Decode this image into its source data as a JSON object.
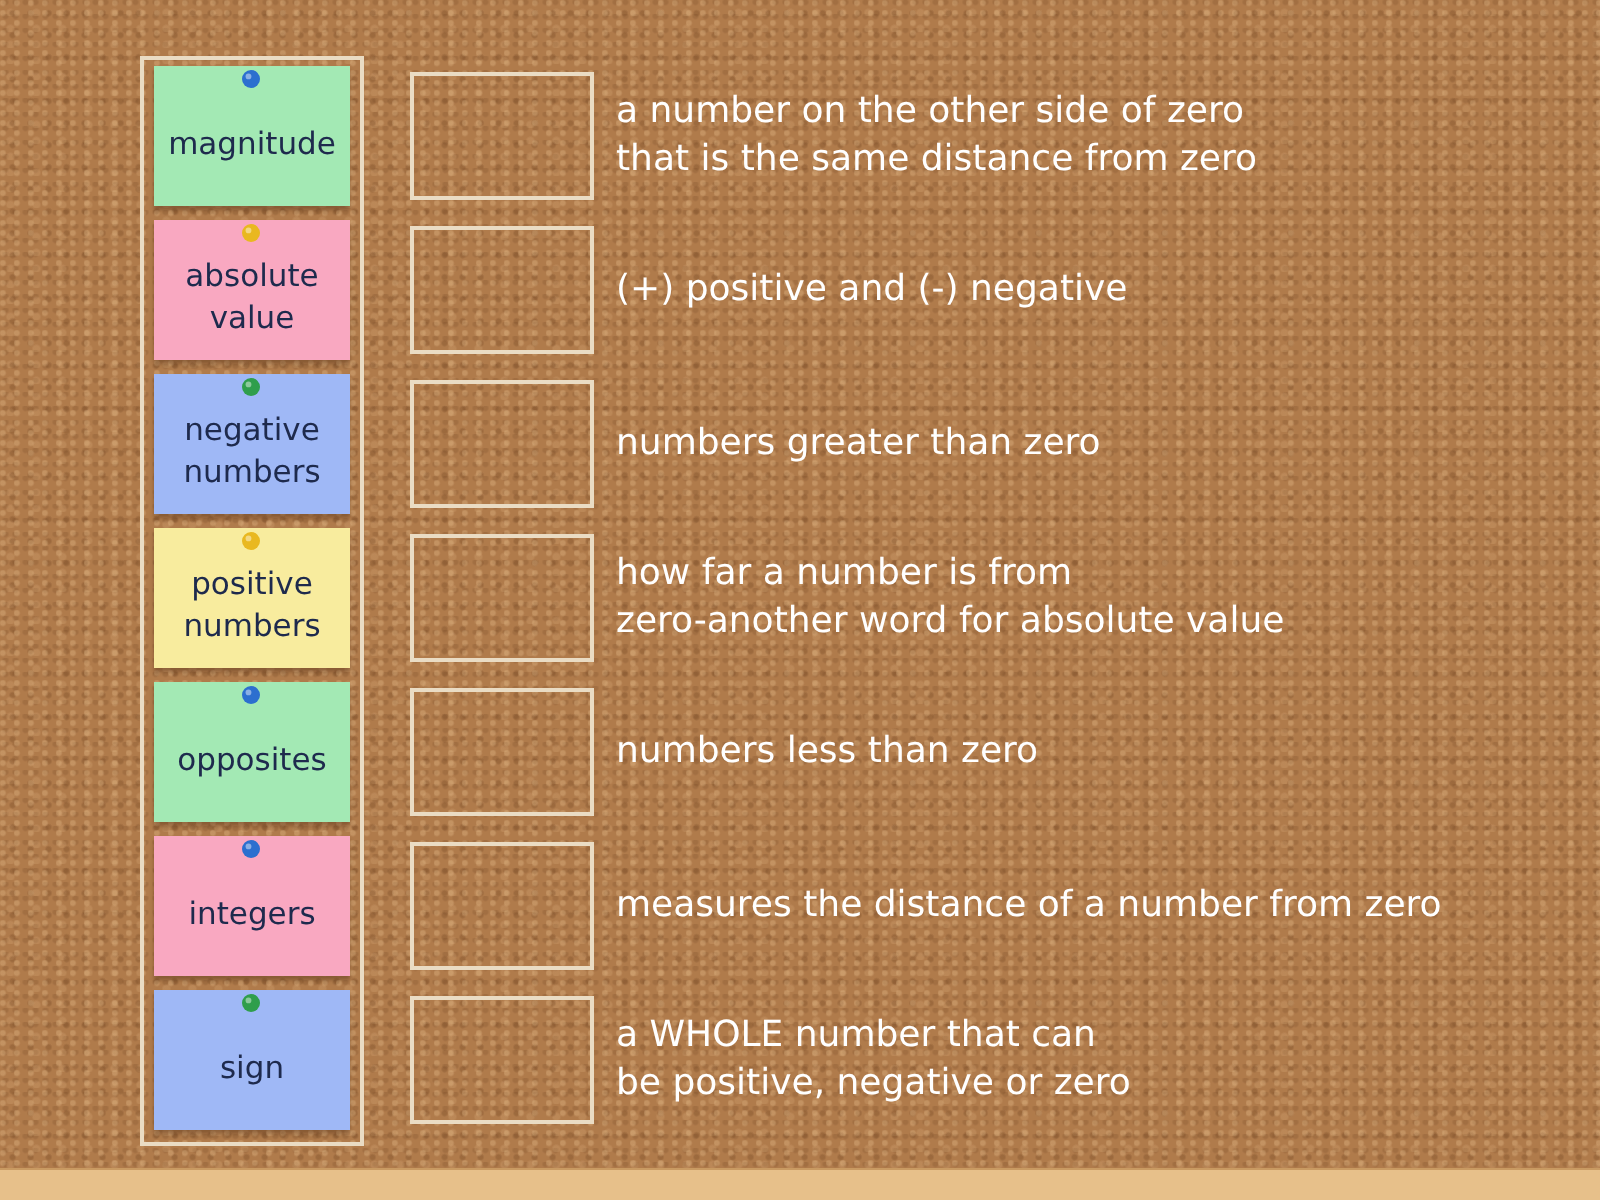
{
  "cards": [
    {
      "label": "magnitude",
      "color": "#a3e9b4",
      "pin": {
        "color": "#2c6fcf"
      }
    },
    {
      "label": "absolute value",
      "color": "#f9a8c1",
      "pin": {
        "color": "#e9b820"
      }
    },
    {
      "label": "negative numbers",
      "color": "#9fb8f6",
      "pin": {
        "color": "#2f9e4c"
      }
    },
    {
      "label": "positive numbers",
      "color": "#f8ec9e",
      "pin": {
        "color": "#e9b820"
      }
    },
    {
      "label": "opposites",
      "color": "#a3e9b4",
      "pin": {
        "color": "#2c6fcf"
      }
    },
    {
      "label": "integers",
      "color": "#f9a8c1",
      "pin": {
        "color": "#2c6fcf"
      }
    },
    {
      "label": "sign",
      "color": "#9fb8f6",
      "pin": {
        "color": "#2f9e4c"
      }
    }
  ],
  "definitions": [
    {
      "lines": [
        "a number on the other side of zero",
        "that is the same distance from zero"
      ]
    },
    {
      "lines": [
        "(+) positive and (-) negative"
      ]
    },
    {
      "lines": [
        "numbers greater than zero"
      ]
    },
    {
      "lines": [
        "how far a number is from",
        "zero-another word for absolute value"
      ]
    },
    {
      "lines": [
        "numbers less than zero"
      ]
    },
    {
      "lines": [
        "measures the distance of a number from zero"
      ]
    },
    {
      "lines": [
        "a WHOLE number that can",
        "be positive, negative or zero"
      ]
    }
  ]
}
